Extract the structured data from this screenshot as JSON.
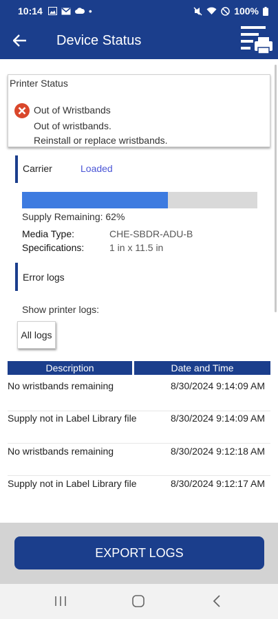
{
  "status_bar": {
    "time": "10:14",
    "dot": "•",
    "battery": "100%",
    "left_icons": [
      "gallery-icon",
      "mail-icon",
      "cloud-icon"
    ],
    "right_icons": [
      "mute-icon",
      "wifi-icon",
      "dnd-icon",
      "battery-icon"
    ]
  },
  "app_bar": {
    "title": "Device Status",
    "back_icon": "back-arrow-icon",
    "menu_icon": "printer-menu-icon"
  },
  "printer_status": {
    "header": "Printer Status",
    "error_title": "Out of Wristbands",
    "error_lines": [
      "Out of wristbands.",
      "Reinstall or replace wristbands."
    ],
    "error_color": "#d9472b"
  },
  "carrier": {
    "label": "Carrier",
    "value": "Loaded"
  },
  "supply": {
    "fraction": 0.62,
    "text": "Supply Remaining: 62%",
    "fill_color": "#3d7be0"
  },
  "media": {
    "type_label": "Media Type:",
    "type_value": "CHE-SBDR-ADU-B",
    "spec_label": "Specifications:",
    "spec_value": "1 in x 11.5 in"
  },
  "error_logs": {
    "label": "Error logs",
    "show_label": "Show printer logs:",
    "filter_button": "All logs"
  },
  "log_table": {
    "headers": [
      "Description",
      "Date and Time"
    ],
    "rows": [
      {
        "description": "No wristbands remaining",
        "datetime": "8/30/2024 9:14:09 AM"
      },
      {
        "description": "Supply not in Label Library file",
        "datetime": "8/30/2024 9:14:09 AM"
      },
      {
        "description": "No wristbands remaining",
        "datetime": "8/30/2024 9:12:18 AM"
      },
      {
        "description": "Supply not in Label Library file",
        "datetime": "8/30/2024 9:12:17 AM"
      }
    ]
  },
  "export_button": "EXPORT LOGS",
  "nav": {
    "recents_icon": "recents-icon",
    "home_icon": "home-icon",
    "back_icon": "nav-back-icon"
  },
  "colors": {
    "brand": "#1b3e8c",
    "link": "#4a55d6"
  }
}
